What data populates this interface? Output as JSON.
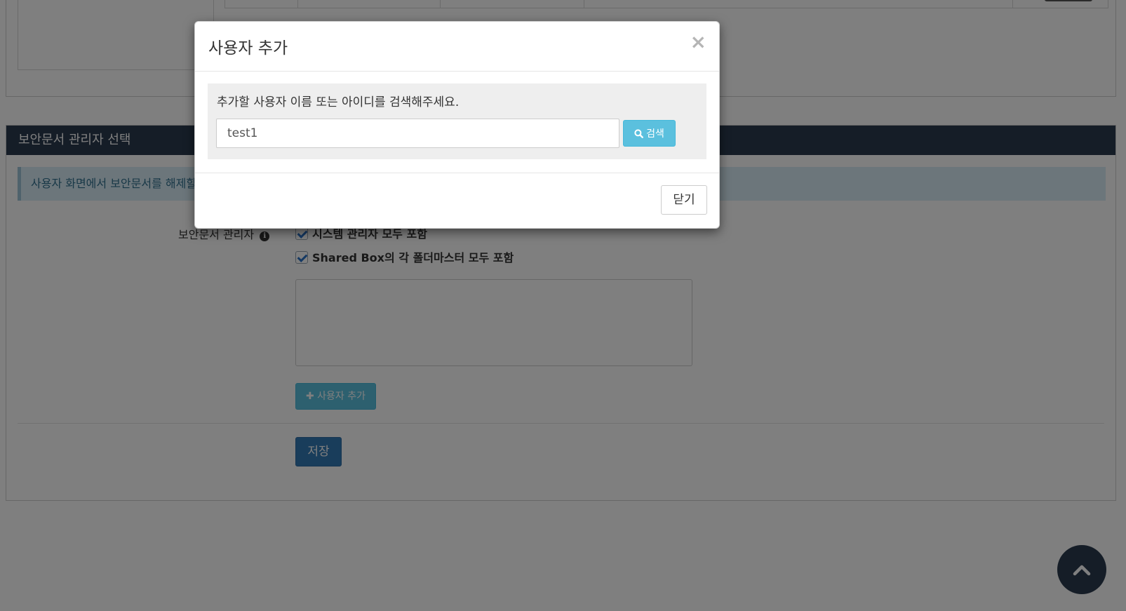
{
  "background": {
    "section": {
      "title": "보안문서 관리자 선택",
      "info_text": "사용자 화면에서 보안문서를 해제할",
      "field_label": "보안문서 관리자",
      "info_icon": "i",
      "checkbox_1": "시스템 관리자 모두 포함",
      "checkbox_2": "Shared Box의 각 폴더마스터 모두 포함",
      "add_user_button": "사용자 추가",
      "save_button": "저장"
    },
    "colors": {
      "header_bg": "#2b3a4f",
      "info_bg": "#d9edf7",
      "primary": "#337ab7",
      "info_button": "#5bc0de"
    }
  },
  "modal": {
    "title": "사용자 추가",
    "close_symbol": "×",
    "search_prompt": "추가할 사용자 이름 또는 아이디를 검색해주세요.",
    "search_value": "test1",
    "search_button": "검색",
    "footer_close_button": "닫기"
  },
  "icons": {
    "search": "search-icon",
    "plus": "plus-icon",
    "info": "info-circle-icon",
    "scroll_top": "chevron-up-icon"
  }
}
